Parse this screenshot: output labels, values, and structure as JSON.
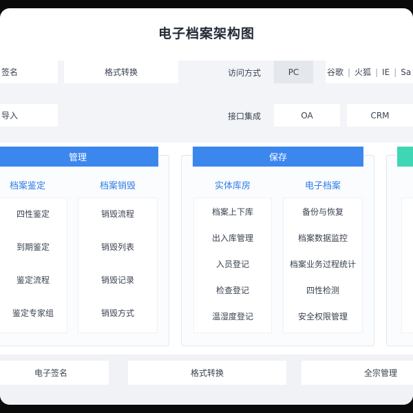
{
  "title": "电子档案架构图",
  "row1": {
    "left_cells": [
      "签名",
      "格式转换"
    ],
    "label": "访问方式",
    "access": [
      "PC",
      "谷歌",
      "火狐",
      "IE",
      "Sa"
    ]
  },
  "row2": {
    "left_cells": [
      "导入"
    ],
    "label": "接口集成",
    "interfaces": [
      "OA",
      "CRM"
    ]
  },
  "panel_manage": {
    "header": "管理",
    "columns": [
      {
        "title": "档案鉴定",
        "items": [
          "四性鉴定",
          "到期鉴定",
          "鉴定流程",
          "鉴定专家组"
        ]
      },
      {
        "title": "档案销毁",
        "items": [
          "销毁流程",
          "销毁列表",
          "销毁记录",
          "销毁方式"
        ]
      }
    ]
  },
  "panel_save": {
    "header": "保存",
    "columns": [
      {
        "title": "实体库房",
        "items": [
          "档案上下库",
          "出入库管理",
          "入员登记",
          "检查登记",
          "温湿度登记"
        ]
      },
      {
        "title": "电子档案",
        "items": [
          "备份与恢复",
          "档案数据监控",
          "档案业务过程统计",
          "四性检测",
          "安全权限管理"
        ]
      }
    ]
  },
  "bottom": [
    "电子签名",
    "格式转换",
    "全宗管理"
  ],
  "colors": {
    "accent_blue": "#3b87ee",
    "accent_green": "#3fd6b4",
    "column_title": "#2e7de6",
    "band_bg": "#f2f4f8"
  }
}
